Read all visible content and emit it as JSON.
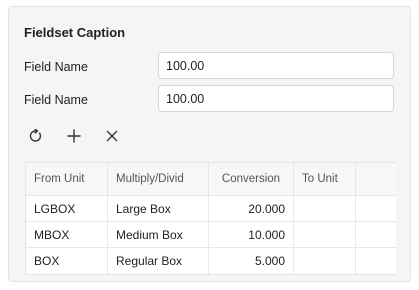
{
  "fieldset": {
    "caption": "Fieldset Caption",
    "fields": [
      {
        "label": "Field Name",
        "value": "100.00"
      },
      {
        "label": "Field Name",
        "value": "100.00"
      }
    ]
  },
  "toolbar": {
    "refresh_icon": "refresh-icon",
    "add_icon": "add-icon",
    "delete_icon": "close-icon"
  },
  "grid": {
    "columns": [
      "From Unit",
      "Multiply/Divid",
      "Conversion",
      "To Unit"
    ],
    "rows": [
      {
        "from_unit": "LGBOX",
        "multiply": "Large Box",
        "conversion": "20.000",
        "to_unit": ""
      },
      {
        "from_unit": "MBOX",
        "multiply": "Medium Box",
        "conversion": "10.000",
        "to_unit": ""
      },
      {
        "from_unit": "BOX",
        "multiply": "Regular Box",
        "conversion": "5.000",
        "to_unit": ""
      }
    ]
  }
}
